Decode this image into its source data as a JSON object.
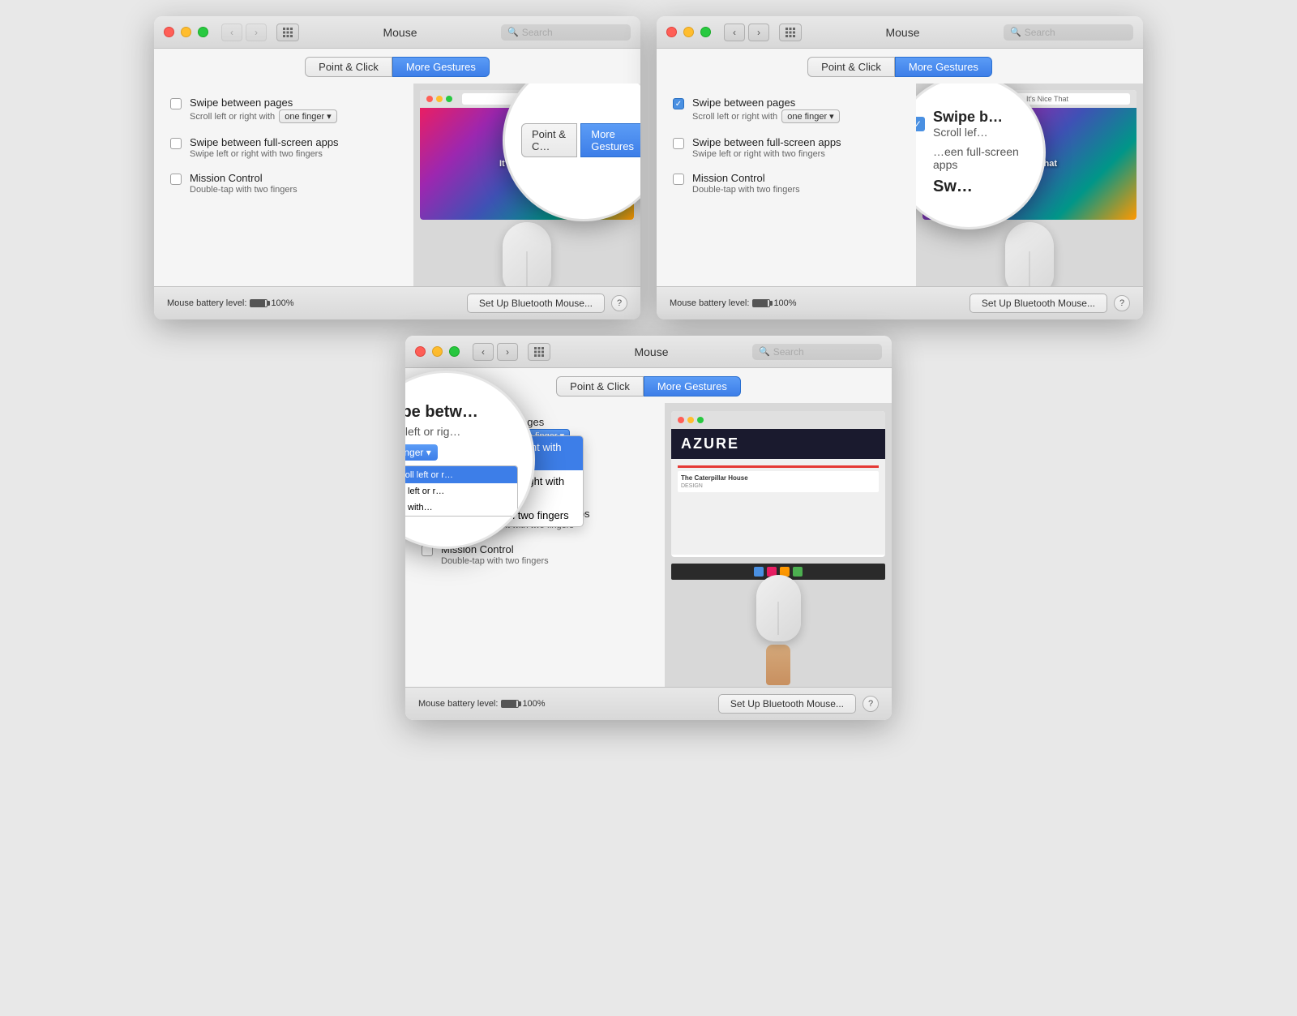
{
  "windows": [
    {
      "id": "window-1",
      "title": "Mouse",
      "traffic_lights": [
        "close",
        "minimize",
        "maximize"
      ],
      "search_placeholder": "Search",
      "tabs": [
        {
          "id": "point-click",
          "label": "Point & Click",
          "active": false
        },
        {
          "id": "more-gestures",
          "label": "More Gestures",
          "active": true
        }
      ],
      "gestures": [
        {
          "id": "swipe-pages",
          "checked": false,
          "label": "Swipe between pages",
          "desc": "Scroll left or right with one finger",
          "has_dropdown": true,
          "dropdown_value": "one finger"
        },
        {
          "id": "swipe-fullscreen",
          "checked": false,
          "label": "Swipe between full-screen apps",
          "desc": "Swipe left or right with two fingers",
          "has_dropdown": false
        },
        {
          "id": "mission-control",
          "checked": false,
          "label": "Mission Control",
          "desc": "Double-tap with two fingers",
          "has_dropdown": false
        }
      ],
      "footer": {
        "battery_label": "Mouse battery level:",
        "battery_percent": "100%",
        "setup_btn": "Set Up Bluetooth Mouse...",
        "help_btn": "?"
      },
      "magnifier": {
        "visible": true,
        "position": "top-right-overlap",
        "active_tab_highlighted": "More Gestures"
      }
    },
    {
      "id": "window-2",
      "title": "Mouse",
      "traffic_lights": [
        "close",
        "minimize",
        "maximize"
      ],
      "search_placeholder": "Search",
      "tabs": [
        {
          "id": "point-click",
          "label": "Point & Click",
          "active": false
        },
        {
          "id": "more-gestures",
          "label": "More Gestures",
          "active": true
        }
      ],
      "gestures": [
        {
          "id": "swipe-pages",
          "checked": true,
          "label": "Swipe between pages",
          "desc": "right with one finger",
          "has_dropdown": true,
          "dropdown_value": "one finger"
        },
        {
          "id": "swipe-fullscreen",
          "checked": false,
          "label": "Swipe between full-screen apps",
          "desc": "or right with two fingers",
          "has_dropdown": false
        },
        {
          "id": "mission-control",
          "checked": false,
          "label": "Mission Control",
          "desc": "Double-tap with two fingers",
          "has_dropdown": false
        }
      ],
      "footer": {
        "battery_label": "Mouse battery level:",
        "battery_percent": "100%",
        "setup_btn": "Set Up Bluetooth Mouse...",
        "help_btn": "?"
      },
      "magnifier": {
        "visible": true,
        "shows_checkbox": true
      }
    },
    {
      "id": "window-3",
      "title": "Mouse",
      "traffic_lights": [
        "close",
        "minimize",
        "maximize"
      ],
      "search_placeholder": "Search",
      "tabs": [
        {
          "id": "point-click",
          "label": "Point & Click",
          "active": false
        },
        {
          "id": "more-gestures",
          "label": "More Gestures",
          "active": true
        }
      ],
      "gestures": [
        {
          "id": "swipe-pages",
          "checked": true,
          "label": "Swipe between pages",
          "desc": "Scroll left or right",
          "has_dropdown": true,
          "dropdown_value": "one finger",
          "dropdown_open": true,
          "dropdown_options": [
            {
              "label": "Scroll left or right with one finger",
              "checked": true
            },
            {
              "label": "Swipe left or right with two fingers",
              "checked": false
            },
            {
              "label": "Swipe with two fingers",
              "checked": false
            }
          ]
        },
        {
          "id": "swipe-fullscreen",
          "checked": false,
          "label": "Swipe between full-screen apps",
          "desc": "with two fingers",
          "has_dropdown": false
        },
        {
          "id": "mission-control",
          "checked": false,
          "label": "Mission Control",
          "desc": "two fingers",
          "has_dropdown": false
        }
      ],
      "footer": {
        "battery_label": "Mouse battery level:",
        "battery_percent": "100%",
        "setup_btn": "Set Up Bluetooth Mouse...",
        "help_btn": "?"
      },
      "magnifier": {
        "visible": true,
        "shows_dropdown": true
      }
    }
  ],
  "preview": {
    "browser_site": "It's Nice That",
    "azure_site": "AZURE",
    "azure_subtitle": "The Caterpillar House",
    "azure_section": "DESIGN"
  }
}
